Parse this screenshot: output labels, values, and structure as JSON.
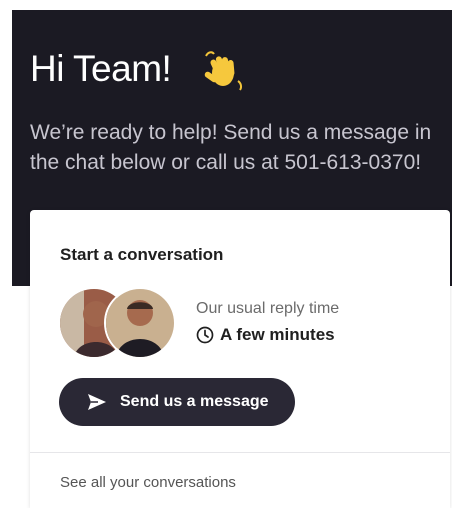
{
  "header": {
    "greeting": "Hi Team!",
    "wave_icon": "waving-hand-icon",
    "intro": "We’re ready to help! Send us a message in the chat below or call us at 501-613-0370!"
  },
  "card": {
    "title": "Start a conversation",
    "avatars": [
      "avatar",
      "avatar"
    ],
    "reply_label": "Our usual reply time",
    "reply_icon": "clock-icon",
    "reply_value": "A few minutes",
    "send_button": {
      "icon": "send-icon",
      "label": "Send us a message"
    },
    "see_all_label": "See all your conversations"
  },
  "colors": {
    "header_bg": "#1b1a23",
    "button_bg": "#2a2835",
    "text_dark": "#202020",
    "text_muted": "#6b6b6b"
  }
}
